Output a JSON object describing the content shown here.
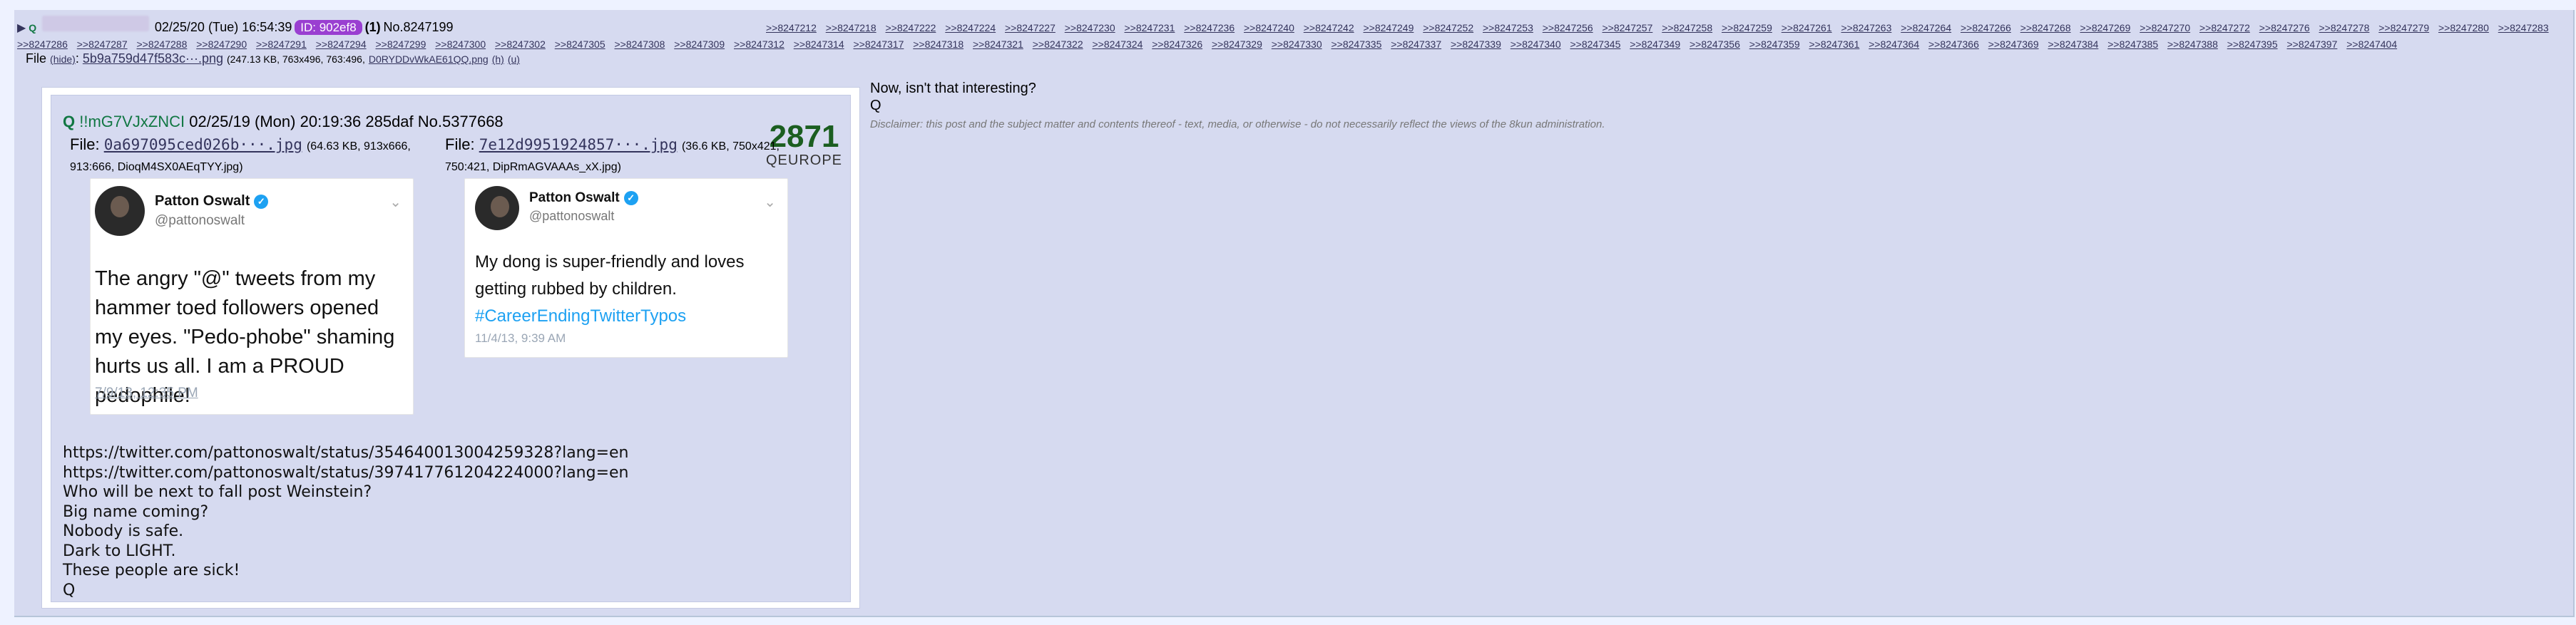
{
  "post": {
    "arrow": "▶",
    "name": "Q",
    "date": "02/25/20 (Tue) 16:54:39",
    "poster_id": "ID: 902ef8",
    "reply_count": "(1)",
    "post_no": "No.8247199",
    "backlinks": [
      ">>8247212",
      ">>8247218",
      ">>8247222",
      ">>8247224",
      ">>8247227",
      ">>8247230",
      ">>8247231",
      ">>8247236",
      ">>8247240",
      ">>8247242",
      ">>8247249",
      ">>8247252",
      ">>8247253",
      ">>8247256",
      ">>8247257",
      ">>8247258",
      ">>8247259",
      ">>8247261",
      ">>8247263",
      ">>8247264",
      ">>8247266",
      ">>8247268",
      ">>8247269",
      ">>8247270",
      ">>8247272",
      ">>8247276",
      ">>8247278",
      ">>8247279",
      ">>8247280",
      ">>8247283",
      ">>8247286",
      ">>8247287",
      ">>8247288",
      ">>8247290",
      ">>8247291",
      ">>8247294",
      ">>8247299",
      ">>8247300",
      ">>8247302",
      ">>8247305",
      ">>8247308",
      ">>8247309",
      ">>8247312",
      ">>8247314",
      ">>8247317",
      ">>8247318",
      ">>8247321",
      ">>8247322",
      ">>8247324",
      ">>8247326",
      ">>8247329",
      ">>8247330",
      ">>8247335",
      ">>8247337",
      ">>8247339",
      ">>8247340",
      ">>8247345",
      ">>8247349",
      ">>8247356",
      ">>8247359",
      ">>8247361",
      ">>8247364",
      ">>8247366",
      ">>8247369",
      ">>8247384",
      ">>8247385",
      ">>8247388",
      ">>8247395",
      ">>8247397",
      ">>8247404"
    ],
    "file": {
      "label": "File",
      "hide": "(hide)",
      "name": "5b9a759d47f583c···.png",
      "meta": "(247.13 KB, 763x496, 763:496,",
      "orig": "D0RYDDvWkAE61QQ.png",
      "h": "(h)",
      "u": "(u)"
    },
    "message": "Now, isn't that interesting?",
    "signature": "Q",
    "disclaimer": "Disclaimer: this post and the subject matter and contents thereof - text, media, or otherwise - do not necessarily reflect the views of the 8kun administration."
  },
  "embedded": {
    "name": "Q",
    "trip": "!!mG7VJxZNCI",
    "date": "02/25/19 (Mon) 20:19:36",
    "id": "285daf",
    "no": "No.5377668",
    "badge_number": "2871",
    "badge_label": "QEUROPE",
    "file1": {
      "label": "File:",
      "name": "0a697095ced026b···.jpg",
      "meta": "(64.63 KB, 913x666, 913:666, DioqM4SX0AEqTYY.jpg)"
    },
    "file2": {
      "label": "File:",
      "name": "7e12d9951924857···.jpg",
      "meta": "(36.6 KB, 750x421, 750:421, DipRmAGVAAAs_xX.jpg)"
    },
    "tweet1": {
      "name": "Patton Oswalt",
      "handle": "@pattonoswalt",
      "text": "The angry \"@\" tweets from my hammer toed followers opened my eyes. \"Pedo-phobe\" shaming hurts us all. I am a PROUD pedophile!",
      "date": "7/9/13, 12:35 PM"
    },
    "tweet2": {
      "name": "Patton Oswalt",
      "handle": "@pattonoswalt",
      "text": "My dong is super-friendly and loves getting rubbed by children.",
      "hashtag": "#CareerEndingTwitterTypos",
      "date": "11/4/13, 9:39 AM"
    },
    "body_lines": [
      "https://twitter.com/pattonoswalt/status/354640013004259328?lang=en",
      "https://twitter.com/pattonoswalt/status/397417761204224000?lang=en",
      "Who will be next to fall post Weinstein?",
      "Big name coming?",
      "Nobody is safe.",
      "Dark to LIGHT.",
      "These people are sick!",
      "Q"
    ]
  },
  "colors": {
    "post_bg": "#d6daf0",
    "page_bg": "#eef2ff",
    "link": "#34345c",
    "name_green": "#117743",
    "id_purple": "#9a3fd1",
    "tweet_blue": "#1da1f2"
  }
}
